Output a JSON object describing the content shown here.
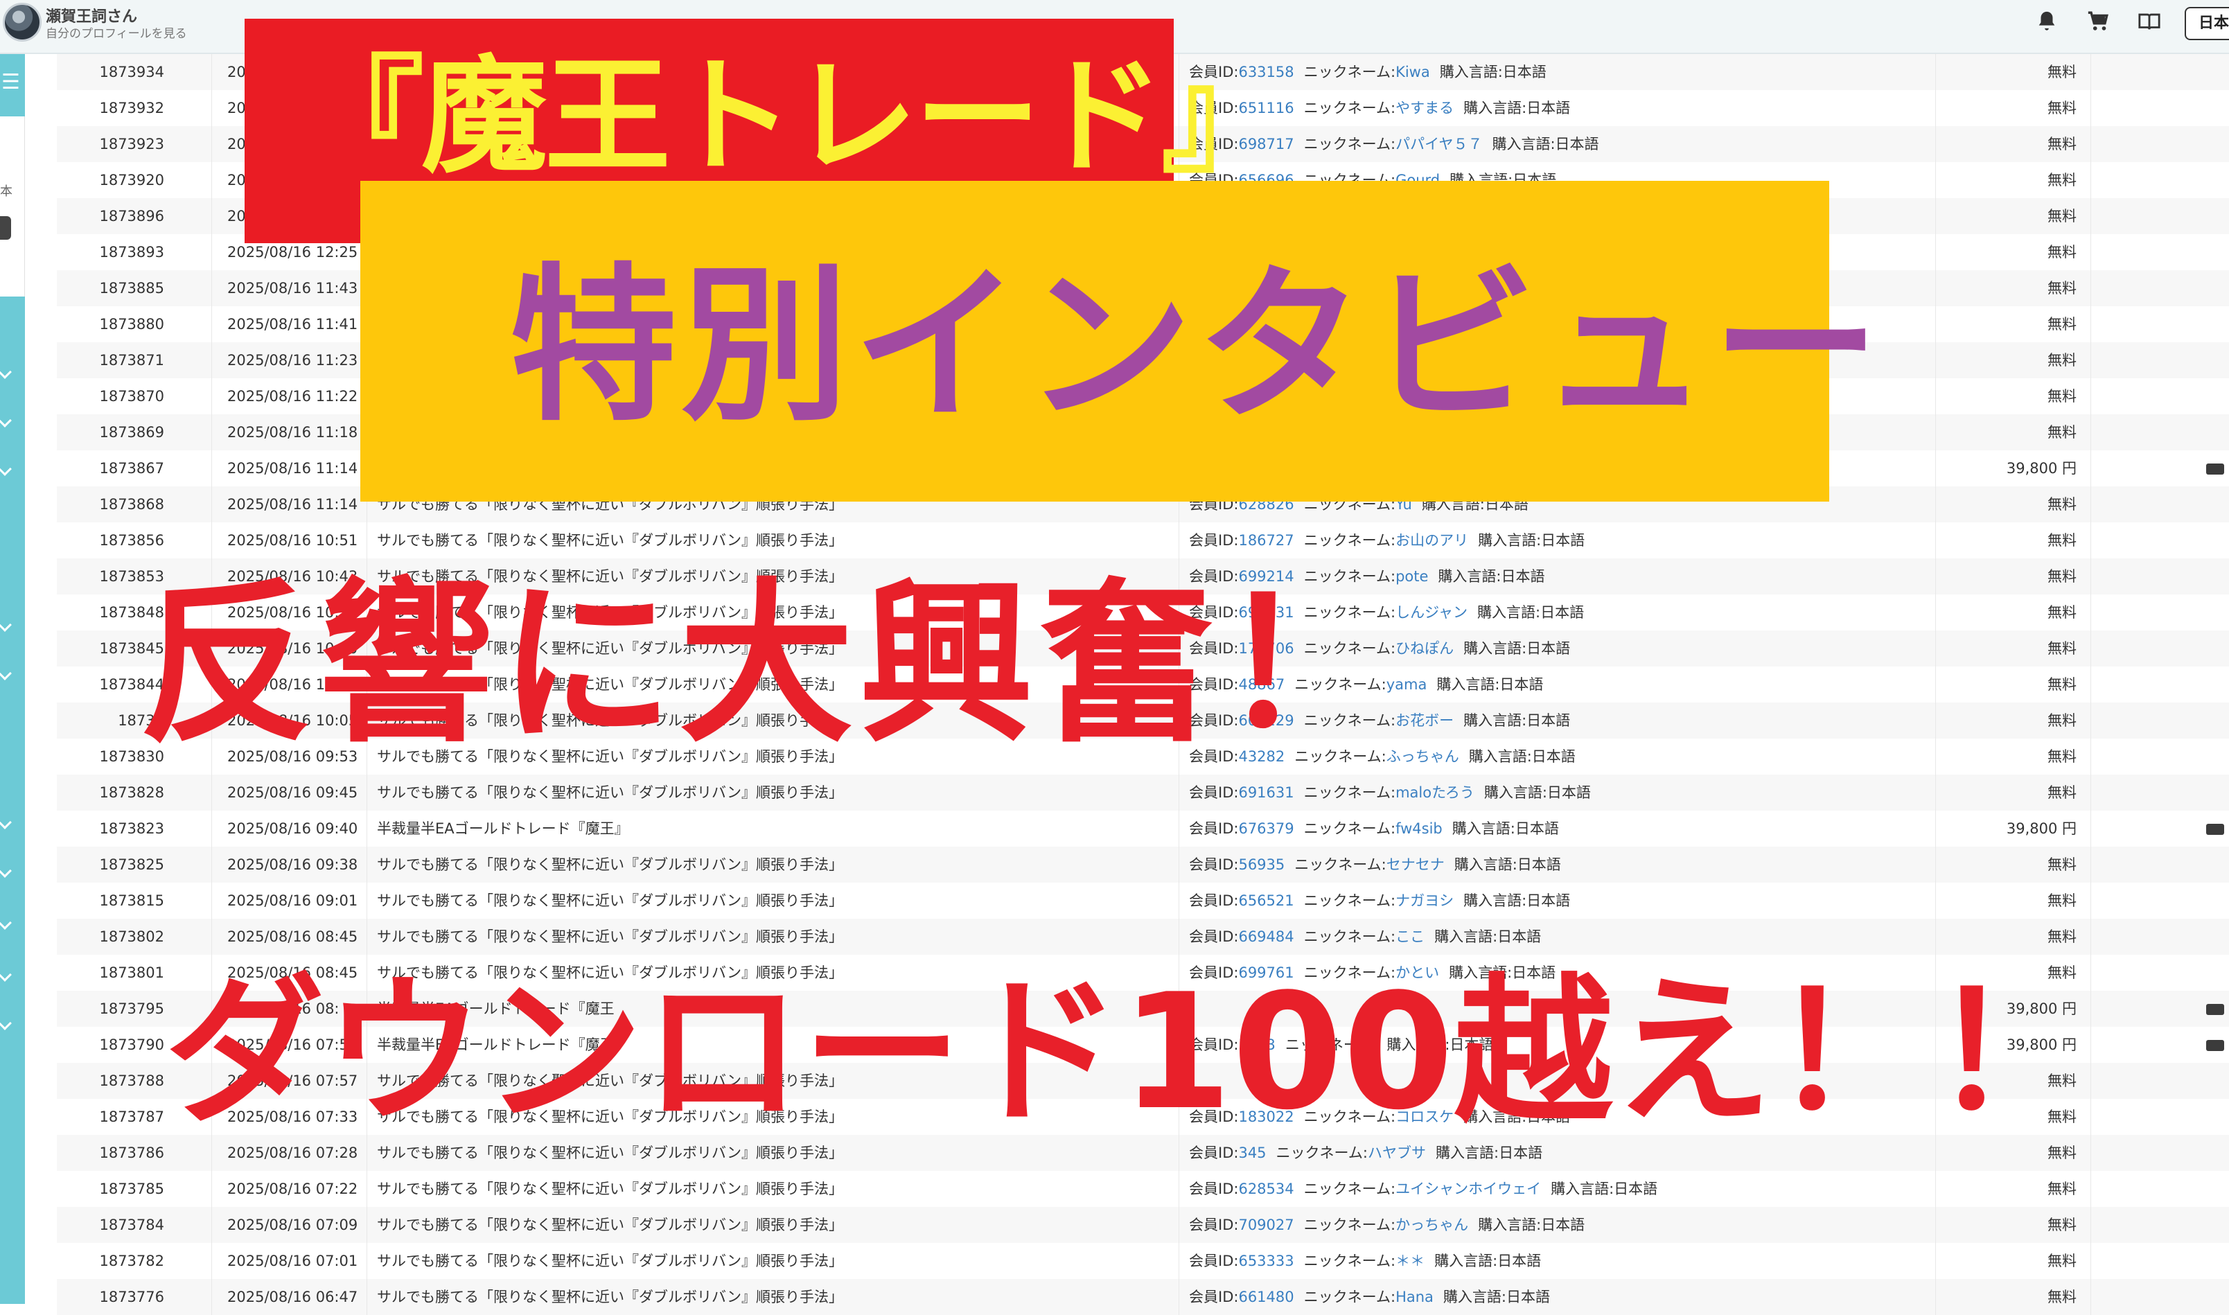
{
  "header": {
    "user_name": "瀬賀王詞さん",
    "profile_link": "自分のプロフィールを見る",
    "lang_button": "日本",
    "icons": [
      "bell-icon",
      "cart-icon",
      "book-icon"
    ]
  },
  "sidebar": {
    "text_fragment": "本"
  },
  "labels": {
    "member_id": "会員ID:",
    "nickname": "ニックネーム:",
    "language": "購入言語:日本語"
  },
  "rows": [
    {
      "id": "1873934",
      "date": "20",
      "title": "",
      "member": "633158",
      "nick": "Kiwa",
      "price": "無料",
      "dash": "-",
      "paid": false
    },
    {
      "id": "1873932",
      "date": "20",
      "title": "",
      "member": "651116",
      "nick": "やすまる",
      "price": "無料",
      "dash": "-",
      "paid": false
    },
    {
      "id": "1873923",
      "date": "20",
      "title": "",
      "member": "698717",
      "nick": "パパイヤ５７",
      "price": "無料",
      "dash": "-",
      "paid": false
    },
    {
      "id": "1873920",
      "date": "20",
      "title": "",
      "member": "656696",
      "nick": "Gourd",
      "price": "無料",
      "dash": "-",
      "paid": false
    },
    {
      "id": "1873896",
      "date": "20",
      "title": "",
      "member": "",
      "nick": "",
      "price": "無料",
      "dash": "-",
      "paid": false
    },
    {
      "id": "1873893",
      "date": "2025/08/16 12:25",
      "title": "",
      "member": "",
      "nick": "",
      "price": "無料",
      "dash": "-",
      "paid": false
    },
    {
      "id": "1873885",
      "date": "2025/08/16 11:43",
      "title": "",
      "member": "",
      "nick": "",
      "price": "無料",
      "dash": "-",
      "paid": false
    },
    {
      "id": "1873880",
      "date": "2025/08/16 11:41",
      "title": "",
      "member": "",
      "nick": "",
      "price": "無料",
      "dash": "-",
      "paid": false
    },
    {
      "id": "1873871",
      "date": "2025/08/16 11:23",
      "title": "",
      "member": "",
      "nick": "",
      "price": "無料",
      "dash": "-",
      "paid": false
    },
    {
      "id": "1873870",
      "date": "2025/08/16 11:22",
      "title": "",
      "member": "",
      "nick": "",
      "price": "無料",
      "dash": "-",
      "paid": false
    },
    {
      "id": "1873869",
      "date": "2025/08/16 11:18",
      "title": "",
      "member": "",
      "nick": "",
      "price": "無料",
      "dash": "-",
      "paid": false
    },
    {
      "id": "1873867",
      "date": "2025/08/16 11:14",
      "title": "",
      "member": "",
      "nick": "",
      "price": "39,800 円",
      "dash": "-",
      "paid": true
    },
    {
      "id": "1873868",
      "date": "2025/08/16 11:14",
      "title": "サルでも勝てる「限りなく聖杯に近い『ダブルボリバン』順張り手法」",
      "member": "628826",
      "nick": "Yu",
      "price": "無料",
      "dash": "-",
      "paid": false
    },
    {
      "id": "1873856",
      "date": "2025/08/16 10:51",
      "title": "サルでも勝てる「限りなく聖杯に近い『ダブルボリバン』順張り手法」",
      "member": "186727",
      "nick": "お山のアリ",
      "price": "無料",
      "dash": "-",
      "paid": false
    },
    {
      "id": "1873853",
      "date": "2025/08/16 10:43",
      "title": "サルでも勝てる「限りなく聖杯に近い『ダブルボリバン』順張り手法」",
      "member": "699214",
      "nick": "pote",
      "price": "無料",
      "dash": "-",
      "paid": false
    },
    {
      "id": "1873848",
      "date": "2025/08/16 10:",
      "title": "サルでも勝てる「限りなく聖杯に近い『ダブルボリバン』順張り手法」",
      "member": "694831",
      "nick": "しんジャン",
      "price": "無料",
      "dash": "-",
      "paid": false
    },
    {
      "id": "1873845",
      "date": "2025/08/16 10:20",
      "title": "サルでも勝てる「限りなく聖杯に近い『ダブルボリバン』順張り手法」",
      "member": "179706",
      "nick": "ひねぽん",
      "price": "無料",
      "dash": "-",
      "paid": false
    },
    {
      "id": "1873844",
      "date": "2025/08/16 10:",
      "title": "サルでも勝てる「限りなく聖杯に近い『ダブルボリバン』順張り手法」",
      "member": "48867",
      "nick": "yama",
      "price": "無料",
      "dash": "-",
      "paid": false
    },
    {
      "id": "18738",
      "date": "2025/08/16 10:05",
      "title": "サルでも勝てる「限りなく聖杯に近い『ダブルボリバン』順張り手法」",
      "member": "600229",
      "nick": "お花ボー",
      "price": "無料",
      "dash": "-",
      "paid": false
    },
    {
      "id": "1873830",
      "date": "2025/08/16 09:53",
      "title": "サルでも勝てる「限りなく聖杯に近い『ダブルボリバン』順張り手法」",
      "member": "43282",
      "nick": "ふっちゃん",
      "price": "無料",
      "dash": "-",
      "paid": false
    },
    {
      "id": "1873828",
      "date": "2025/08/16 09:45",
      "title": "サルでも勝てる「限りなく聖杯に近い『ダブルボリバン』順張り手法」",
      "member": "691631",
      "nick": "maloたろう",
      "price": "無料",
      "dash": "-",
      "paid": false
    },
    {
      "id": "1873823",
      "date": "2025/08/16 09:40",
      "title": "半裁量半EAゴールドトレード『魔王』",
      "member": "676379",
      "nick": "fw4sib",
      "price": "39,800 円",
      "dash": "-",
      "paid": true
    },
    {
      "id": "1873825",
      "date": "2025/08/16 09:38",
      "title": "サルでも勝てる「限りなく聖杯に近い『ダブルボリバン』順張り手法」",
      "member": "56935",
      "nick": "セナセナ",
      "price": "無料",
      "dash": "-",
      "paid": false
    },
    {
      "id": "1873815",
      "date": "2025/08/16 09:01",
      "title": "サルでも勝てる「限りなく聖杯に近い『ダブルボリバン』順張り手法」",
      "member": "656521",
      "nick": "ナガヨシ",
      "price": "無料",
      "dash": "-",
      "paid": false
    },
    {
      "id": "1873802",
      "date": "2025/08/16 08:45",
      "title": "サルでも勝てる「限りなく聖杯に近い『ダブルボリバン』順張り手法」",
      "member": "669484",
      "nick": "ここ",
      "price": "無料",
      "dash": "-",
      "paid": false
    },
    {
      "id": "1873801",
      "date": "2025/08/16 08:45",
      "title": "サルでも勝てる「限りなく聖杯に近い『ダブルボリバン』順張り手法」",
      "member": "699761",
      "nick": "かとい",
      "price": "無料",
      "dash": "-",
      "paid": false
    },
    {
      "id": "1873795",
      "date": "2025/08/16 08:",
      "title": "半裁量半EAゴールドトレード『魔王",
      "member": "",
      "nick": "",
      "price": "39,800 円",
      "dash": "-",
      "paid": true
    },
    {
      "id": "1873790",
      "date": "2025/08/16 07:57",
      "title": "半裁量半EAゴールドトレード『魔王",
      "member": "3173",
      "nick": "",
      "price": "39,800 円",
      "dash": "-",
      "paid": true
    },
    {
      "id": "1873788",
      "date": "2025/08/16 07:57",
      "title": "サルでも勝てる「限りなく聖杯に近い『ダブルボリバン』順張り手法」",
      "member": "",
      "nick": "",
      "price": "無料",
      "dash": "-",
      "paid": false
    },
    {
      "id": "1873787",
      "date": "2025/08/16 07:33",
      "title": "サルでも勝てる「限りなく聖杯に近い『ダブルボリバン』順張り手法」",
      "member": "183022",
      "nick": "コロスケ",
      "price": "無料",
      "dash": "-",
      "paid": false
    },
    {
      "id": "1873786",
      "date": "2025/08/16 07:28",
      "title": "サルでも勝てる「限りなく聖杯に近い『ダブルボリバン』順張り手法」",
      "member": "345",
      "nick": "ハヤブサ",
      "price": "無料",
      "dash": "-",
      "paid": false
    },
    {
      "id": "1873785",
      "date": "2025/08/16 07:22",
      "title": "サルでも勝てる「限りなく聖杯に近い『ダブルボリバン』順張り手法」",
      "member": "628534",
      "nick": "ユイシャンホイウェイ",
      "price": "無料",
      "dash": "-",
      "paid": false
    },
    {
      "id": "1873784",
      "date": "2025/08/16 07:09",
      "title": "サルでも勝てる「限りなく聖杯に近い『ダブルボリバン』順張り手法」",
      "member": "709027",
      "nick": "かっちゃん",
      "price": "無料",
      "dash": "-",
      "paid": false
    },
    {
      "id": "1873782",
      "date": "2025/08/16 07:01",
      "title": "サルでも勝てる「限りなく聖杯に近い『ダブルボリバン』順張り手法」",
      "member": "653333",
      "nick": "＊＊",
      "price": "無料",
      "dash": "-",
      "paid": false
    },
    {
      "id": "1873776",
      "date": "2025/08/16 06:47",
      "title": "サルでも勝てる「限りなく聖杯に近い『ダブルボリバン』順張り手法」",
      "member": "661480",
      "nick": "Hana",
      "price": "無料",
      "dash": "-",
      "paid": false
    }
  ],
  "overlay": {
    "red_banner": "『魔王トレード』",
    "yellow_banner": "特別インタビュー",
    "headline1": "反響に大興奮！",
    "headline2": "ダウンロード100越え！！",
    "colors": {
      "red": "#ea1c24",
      "yellow": "#fec70b",
      "purple": "#a24aa1",
      "banner_text": "#fbf033"
    }
  }
}
